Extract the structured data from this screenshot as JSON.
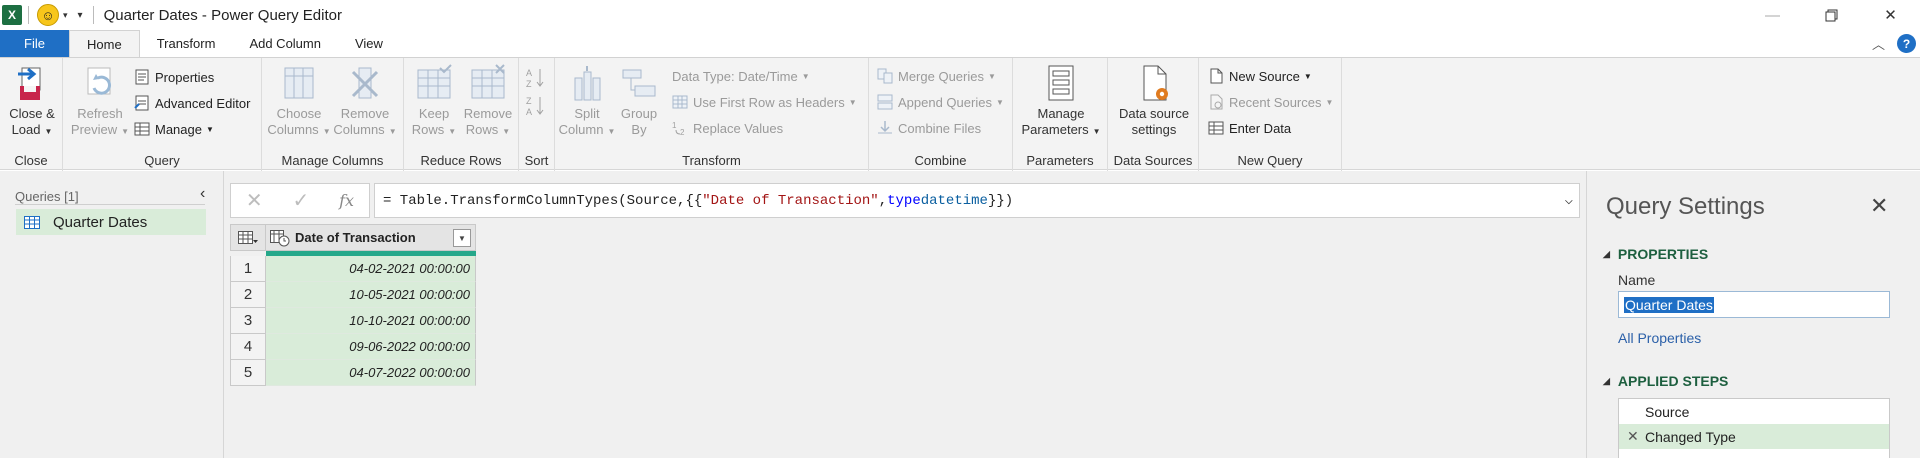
{
  "window": {
    "title": "Quarter Dates - Power Query Editor",
    "app_icon": "X",
    "smiley": "☺"
  },
  "tabs": [
    {
      "label": "File"
    },
    {
      "label": "Home"
    },
    {
      "label": "Transform"
    },
    {
      "label": "Add Column"
    },
    {
      "label": "View"
    }
  ],
  "ribbon": {
    "close_group": {
      "label": "Close",
      "close_load": [
        "Close &",
        "Load"
      ]
    },
    "query_group": {
      "label": "Query",
      "refresh": [
        "Refresh",
        "Preview"
      ],
      "properties": "Properties",
      "advanced_editor": "Advanced Editor",
      "manage": "Manage"
    },
    "manage_columns_group": {
      "label": "Manage Columns",
      "choose": [
        "Choose",
        "Columns"
      ],
      "remove": [
        "Remove",
        "Columns"
      ]
    },
    "reduce_rows_group": {
      "label": "Reduce Rows",
      "keep": [
        "Keep",
        "Rows"
      ],
      "remove": [
        "Remove",
        "Rows"
      ]
    },
    "sort_group": {
      "label": "Sort"
    },
    "transform_group": {
      "label": "Transform",
      "split": [
        "Split",
        "Column"
      ],
      "group": [
        "Group",
        "By"
      ],
      "data_type": "Data Type: Date/Time",
      "first_row": "Use First Row as Headers",
      "replace": "Replace Values"
    },
    "combine_group": {
      "label": "Combine",
      "merge": "Merge Queries",
      "append": "Append Queries",
      "combine_files": "Combine Files"
    },
    "parameters_group": {
      "label": "Parameters",
      "manage": [
        "Manage",
        "Parameters"
      ]
    },
    "data_sources_group": {
      "label": "Data Sources",
      "settings": [
        "Data source",
        "settings"
      ]
    },
    "new_query_group": {
      "label": "New Query",
      "new_source": "New Source",
      "recent_sources": "Recent Sources",
      "enter_data": "Enter Data"
    }
  },
  "queries_pane": {
    "header": "Queries [1]",
    "items": [
      {
        "label": "Quarter Dates"
      }
    ]
  },
  "formula": {
    "prefix": "= Table.TransformColumnTypes(Source,{{",
    "string": "\"Date of Transaction\"",
    "sep": ", ",
    "kw": "type",
    "space": " ",
    "type_name": "datetime",
    "suffix": "}})"
  },
  "grid": {
    "column": "Date of Transaction",
    "rows": [
      {
        "num": "1",
        "value": "04-02-2021 00:00:00"
      },
      {
        "num": "2",
        "value": "10-05-2021 00:00:00"
      },
      {
        "num": "3",
        "value": "10-10-2021 00:00:00"
      },
      {
        "num": "4",
        "value": "09-06-2022 00:00:00"
      },
      {
        "num": "5",
        "value": "04-07-2022 00:00:00"
      }
    ]
  },
  "settings": {
    "title": "Query Settings",
    "properties_header": "PROPERTIES",
    "name_label": "Name",
    "name_value": "Quarter Dates",
    "all_properties": "All Properties",
    "applied_steps_header": "APPLIED STEPS",
    "steps": [
      {
        "label": "Source"
      },
      {
        "label": "Changed Type"
      }
    ]
  },
  "colors": {
    "accent": "#1f6fc5",
    "selected_green": "#d9ecd9",
    "quality_bar": "#25a88a",
    "section_header": "#1d5f3f"
  }
}
